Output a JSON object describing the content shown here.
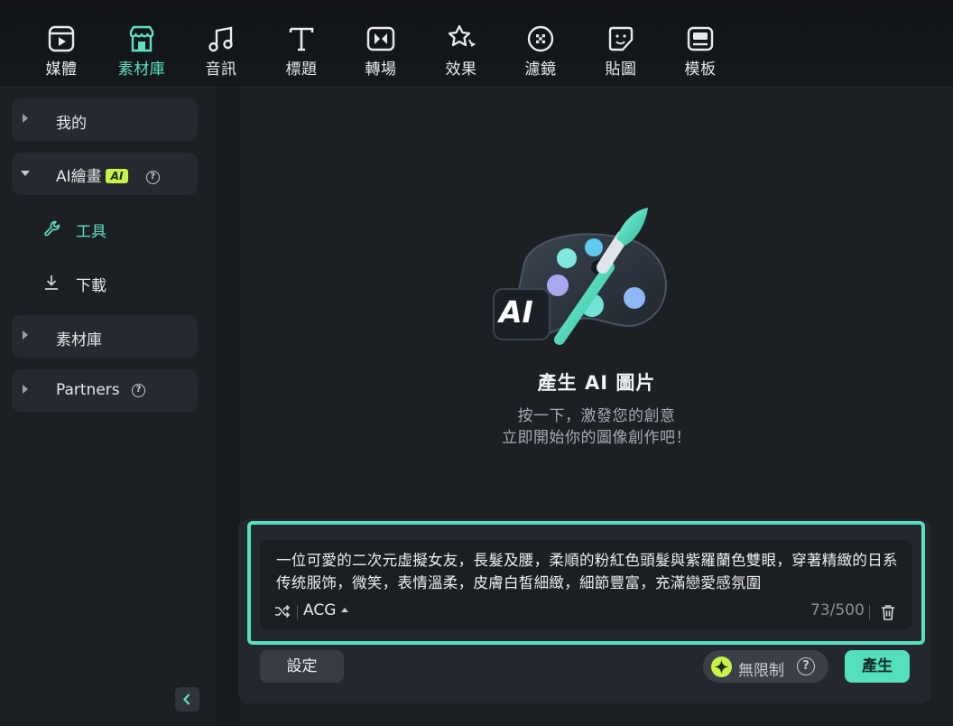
{
  "toolbar": {
    "tabs": [
      {
        "label": "媒體",
        "icon": "media-icon"
      },
      {
        "label": "素材庫",
        "icon": "store-icon",
        "active": true
      },
      {
        "label": "音訊",
        "icon": "music-icon"
      },
      {
        "label": "標題",
        "icon": "title-icon"
      },
      {
        "label": "轉場",
        "icon": "transition-icon"
      },
      {
        "label": "效果",
        "icon": "effects-icon"
      },
      {
        "label": "濾鏡",
        "icon": "filter-icon"
      },
      {
        "label": "貼圖",
        "icon": "sticker-icon"
      },
      {
        "label": "模板",
        "icon": "template-icon"
      }
    ]
  },
  "sidebar": {
    "mine": "我的",
    "ai_paint": "AI繪畫",
    "ai_badge": "AI",
    "tools": "工具",
    "download": "下載",
    "library": "素材庫",
    "partners": "Partners",
    "help_glyph": "?"
  },
  "hero": {
    "logo_text": "AI",
    "title": "產生 AI 圖片",
    "subtitle_line1": "按一下，激發您的創意",
    "subtitle_line2": "立即開始你的圖像創作吧！"
  },
  "prompt": {
    "text": "一位可愛的二次元虛擬女友，長髮及腰，柔順的粉紅色頭髮與紫羅蘭色雙眼，穿著精緻的日系传统服饰，微笑，表情溫柔，皮膚白皙細緻，細節豐富，充滿戀愛感氛圍",
    "style": "ACG",
    "counter": "73/500"
  },
  "actions": {
    "settings": "設定",
    "unlimited": "無限制",
    "generate": "產生"
  },
  "colors": {
    "accent": "#58e0c3",
    "badge": "#c7f24a",
    "background": "#1c1f24"
  }
}
